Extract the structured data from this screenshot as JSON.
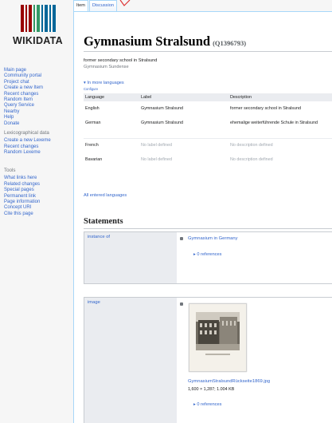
{
  "sidebar": {
    "wordmark": "WIKIDATA",
    "main": [
      "Main page",
      "Community portal",
      "Project chat",
      "Create a new Item",
      "Recent changes",
      "Random Item",
      "Query Service",
      "Nearby",
      "Help",
      "Donate"
    ],
    "lexicographical": {
      "heading": "Lexicographical data",
      "items": [
        "Create a new Lexeme",
        "Recent changes",
        "Random Lexeme"
      ]
    },
    "tools": {
      "heading": "Tools",
      "items": [
        "What links here",
        "Related changes",
        "Special pages",
        "Permanent link",
        "Page information",
        "Concept URI",
        "Cite this page"
      ]
    }
  },
  "tabs": {
    "item": "Item",
    "discussion": "Discussion"
  },
  "page": {
    "title": "Gymnasium Stralsund",
    "qid": "(Q1396793)",
    "description": "former secondary school in Stralsund",
    "alias": "Gymnasium Sundense",
    "more_languages": "In more languages",
    "configure": "Configure"
  },
  "terms_table": {
    "headers": {
      "language": "Language",
      "label": "Label",
      "description": "Description"
    },
    "rows": [
      {
        "language": "English",
        "label": "Gymnasium Stralsund",
        "description": "former secondary school in Stralsund"
      },
      {
        "language": "German",
        "label": "Gymnasium Stralsund",
        "description": "ehemalige weiterführende Schule in Stralsund"
      },
      {
        "language": "French",
        "label": "No label defined",
        "description": "No description defined"
      },
      {
        "language": "Bavarian",
        "label": "No label defined",
        "description": "No description defined"
      }
    ],
    "all_languages": "All entered languages"
  },
  "statements": {
    "heading": "Statements",
    "instance_of": {
      "property": "instance of",
      "value": "Gymnasium in Germany",
      "references": "0 references"
    },
    "image": {
      "property": "image",
      "file": "GymnasiumStralsundRückseite1869.jpg",
      "meta": "1,600 × 1,287; 1.004 KB",
      "references": "0 references"
    }
  },
  "colors": {
    "link": "#3366cc",
    "border": "#a7d7f9",
    "logo_red": "#990000",
    "logo_green": "#339966",
    "logo_blue": "#006699"
  }
}
